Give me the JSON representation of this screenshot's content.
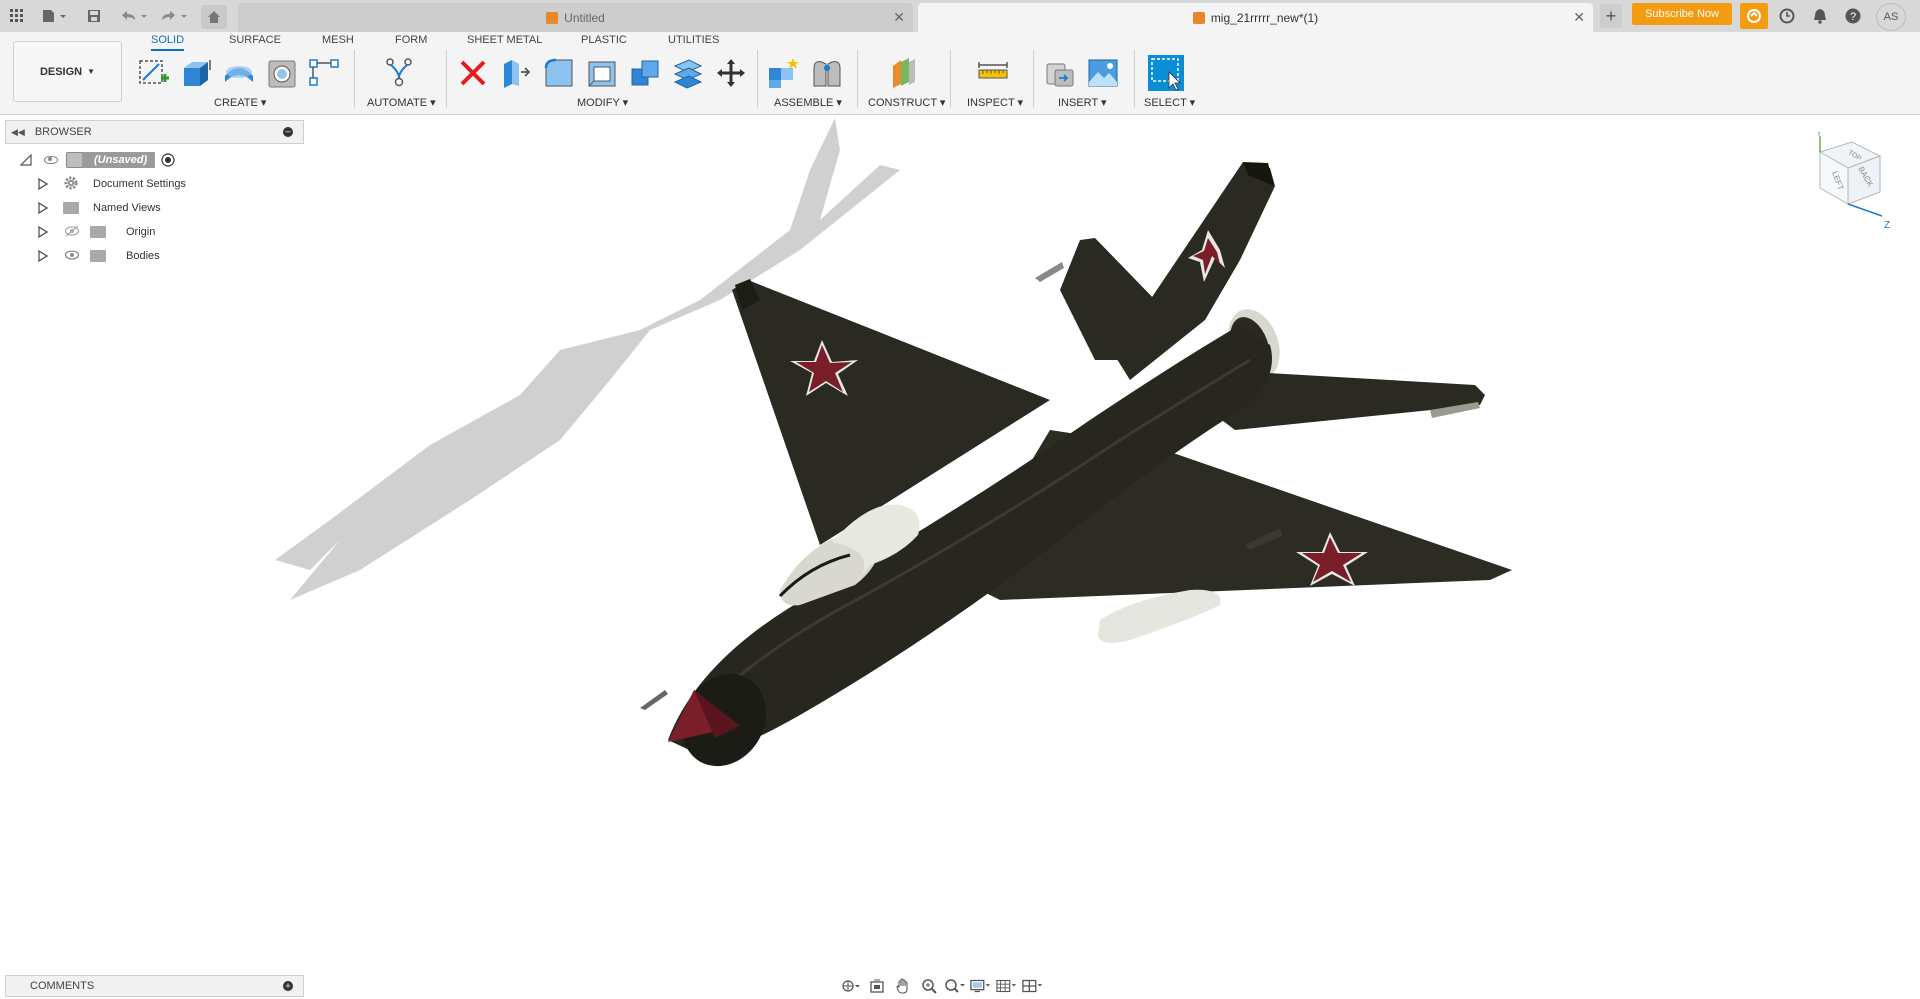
{
  "titlebar": {
    "tabs": [
      {
        "label": "Untitled",
        "active": false
      },
      {
        "label": "mig_21rrrrr_new*(1)",
        "active": true
      }
    ],
    "subscribe_label": "Subscribe Now",
    "user_initials": "AS"
  },
  "toolbar": {
    "workspace_label": "DESIGN",
    "tabs": [
      "SOLID",
      "SURFACE",
      "MESH",
      "FORM",
      "SHEET METAL",
      "PLASTIC",
      "UTILITIES"
    ],
    "groups": [
      "CREATE",
      "AUTOMATE",
      "MODIFY",
      "ASSEMBLE",
      "CONSTRUCT",
      "INSPECT",
      "INSERT",
      "SELECT"
    ]
  },
  "browser": {
    "title": "BROWSER",
    "root_label": "(Unsaved)",
    "items": [
      {
        "label": "Document Settings",
        "icon": "gear-icon"
      },
      {
        "label": "Named Views",
        "icon": "folder-icon"
      },
      {
        "label": "Origin",
        "icon": "folder-icon"
      },
      {
        "label": "Bodies",
        "icon": "folder-icon"
      }
    ]
  },
  "comments": {
    "title": "COMMENTS"
  },
  "viewcube": {
    "face_labels": [
      "LEFT",
      "BACK",
      "TOP"
    ],
    "axis_y": "Y",
    "axis_z": "Z"
  },
  "colors": {
    "accent": "#0a6ebd",
    "subscribe": "#f39c12",
    "aircraft_body": "#2c2c22",
    "star_red": "#7a1f2a"
  }
}
